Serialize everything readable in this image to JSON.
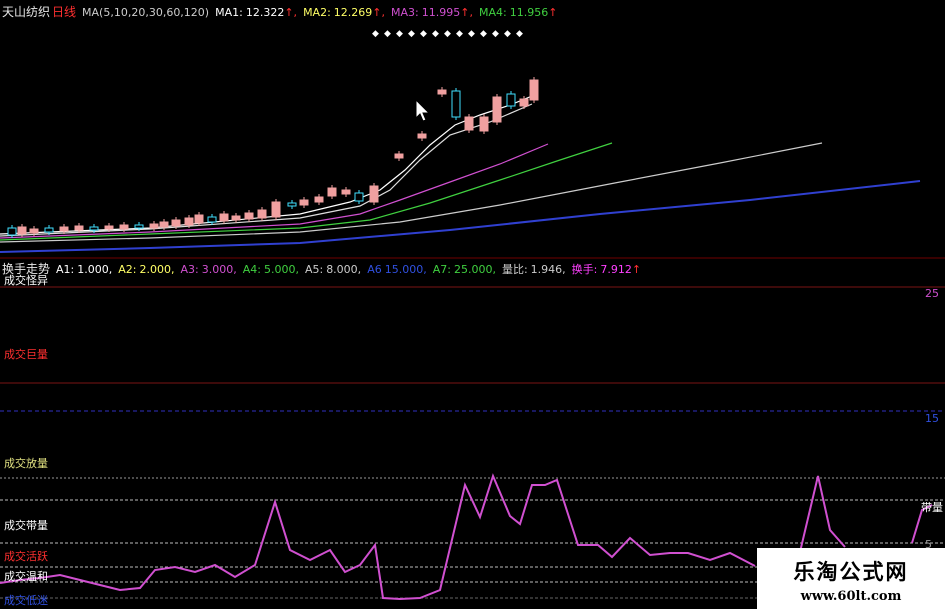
{
  "top_header": {
    "stock_name": "天山纺织",
    "period": "日线",
    "ma_def": "MA(5,10,20,30,60,120)",
    "ma1_label": "MA1:",
    "ma1_value": "12.322",
    "ma2_label": "MA2:",
    "ma2_value": "12.269",
    "ma3_label": "MA3:",
    "ma3_value": "11.995",
    "ma4_label": "MA4:",
    "ma4_value": "11.956",
    "colors": {
      "stock_name": "#e8e8e8",
      "period": "#ff3030",
      "ma_def": "#cccccc",
      "ma1": "#ffffff",
      "ma2": "#ffff66",
      "ma3": "#d050d0",
      "ma4": "#40d040",
      "ma5": "#cccccc",
      "ma6": "#3040d0",
      "candle_up": "#f0a0a0",
      "candle_down": "#40e0ff"
    }
  },
  "mid_header": {
    "title": "换手走势",
    "a1_label": "A1:",
    "a1_value": "1.000,",
    "a2_label": "A2:",
    "a2_value": "2.000,",
    "a3_label": "A3:",
    "a3_value": "3.000,",
    "a4_label": "A4:",
    "a4_value": "5.000,",
    "a5_label": "A5:",
    "a5_value": "8.000,",
    "a6_label": "A6",
    "a6_value": "15.000,",
    "a7_label": "A7:",
    "a7_value": "25.000,",
    "lb_label": "量比:",
    "lb_value": "1.946,",
    "hs_label": "换手:",
    "hs_value": "7.912"
  },
  "zone_labels": {
    "z1": "成交怪异",
    "z2": "成交巨量",
    "z3": "成交放量",
    "z4": "成交带量",
    "z5": "成交活跃",
    "z6": "成交温和",
    "z7": "成交低迷"
  },
  "right_labels": {
    "r25": "25",
    "r15": "15",
    "r_band": "带量",
    "r5": "5"
  },
  "watermark": {
    "line1": "乐淘公式网",
    "line2": "www.60lt.com"
  }
}
